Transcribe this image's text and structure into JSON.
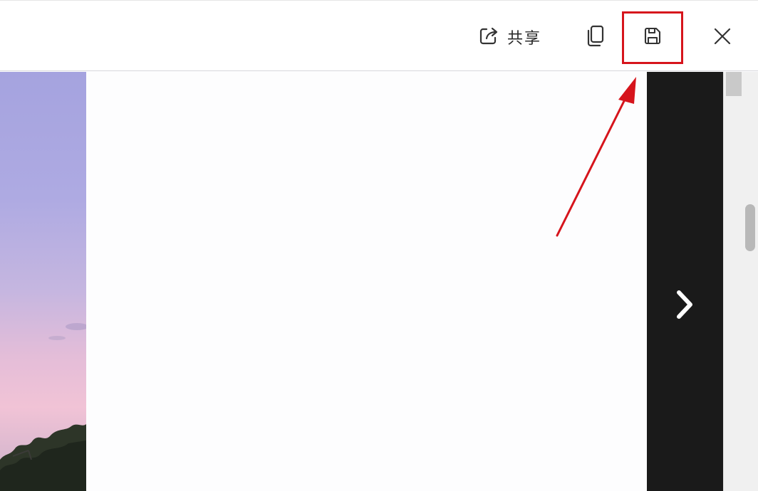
{
  "toolbar": {
    "share_label": "共享",
    "icons": {
      "share": "share-icon",
      "copy": "copy-icon",
      "save": "save-icon",
      "close": "close-icon"
    }
  },
  "side_panel": {
    "icon": "chevron-right-icon"
  },
  "colors": {
    "annotation": "#d6141c",
    "panel": "#1a1a1a",
    "toolbar_bg": "#ffffff"
  }
}
